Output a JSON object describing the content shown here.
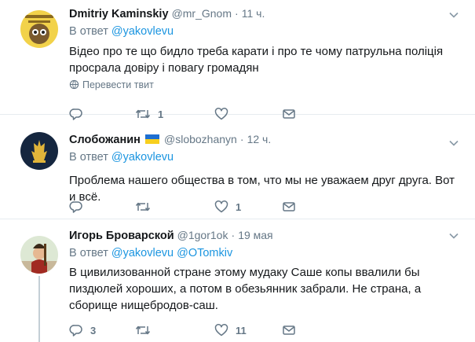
{
  "tweets": [
    {
      "name": "Dmitriy Kaminskiy",
      "flag": "",
      "handle": "@mr_Gnom",
      "dot": "·",
      "time": "11 ч.",
      "reply_prefix": "В ответ",
      "mentions": [
        "@yakovlevu"
      ],
      "text": "Відео про те що бидло треба карати і про те чому патрульна поліція просрала довіру і повагу громадян",
      "translate": "Перевести твит",
      "counts": {
        "reply": "",
        "retweet": "1",
        "like": ""
      }
    },
    {
      "name": "Слобожанин",
      "flag": "ukraine-flag",
      "handle": "@slobozhanyn",
      "dot": "·",
      "time": "12 ч.",
      "reply_prefix": "В ответ",
      "mentions": [
        "@yakovlevu"
      ],
      "text": "Проблема нашего общества в том, что мы не уважаем друг друга. Вот и всё.",
      "counts": {
        "reply": "",
        "retweet": "",
        "like": "1"
      }
    },
    {
      "name": "Игорь Броварской",
      "flag": "",
      "handle": "@1gor1ok",
      "dot": "·",
      "time": "19 мая",
      "reply_prefix": "В ответ",
      "mentions": [
        "@yakovlevu",
        "@OTomkiv"
      ],
      "text": "В цивилизованной стране этому мудаку Саше копы ввалили бы пиздюлей хороших, а потом в обезьянник забрали. Не страна, а сборище нищебродов-саш.",
      "counts": {
        "reply": "3",
        "retweet": "",
        "like": "11"
      }
    }
  ],
  "colors": {
    "link": "#1b95e0",
    "secondary": "#657786",
    "divider": "#e6ecf0",
    "thread": "#c4cfd6"
  }
}
